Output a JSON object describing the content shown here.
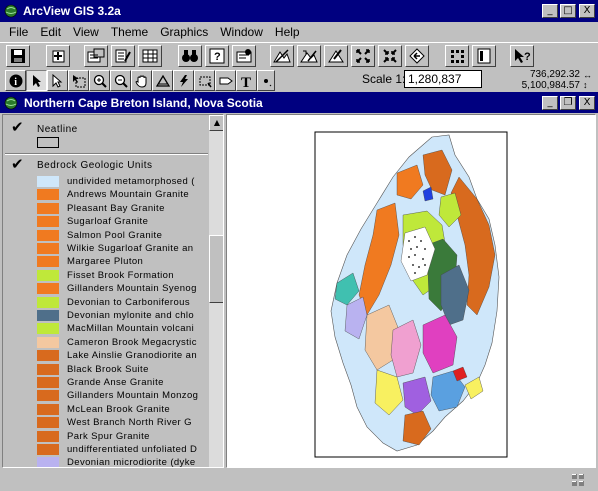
{
  "app": {
    "title": "ArcView GIS 3.2a",
    "window_buttons": [
      "_",
      "□",
      "X"
    ]
  },
  "menu": [
    "File",
    "Edit",
    "View",
    "Theme",
    "Graphics",
    "Window",
    "Help"
  ],
  "toolbar": {
    "buttons": [
      "save",
      "add-theme",
      "theme-properties",
      "edit-legend",
      "open-table",
      "find",
      "query-builder",
      "locate-address",
      "zoom-to-full-extent",
      "zoom-to-active-themes",
      "zoom-to-selected",
      "zoom-previous",
      "select-features",
      "help"
    ],
    "tools": [
      "identify",
      "pointer",
      "vertex-edit",
      "select-feature",
      "zoom-in",
      "zoom-out",
      "pan",
      "measure",
      "hotlink",
      "area-of-interest",
      "label",
      "text",
      "draw-point"
    ]
  },
  "scale": {
    "label": "Scale 1:",
    "value": "1,280,837"
  },
  "coords": {
    "x": "736,292.32",
    "y": "5,100,984.57"
  },
  "view": {
    "title": "Northern Cape Breton Island, Nova Scotia"
  },
  "toc": {
    "neatline": {
      "name": "Neatline",
      "checked": true
    },
    "bedrock": {
      "name": "Bedrock Geologic Units",
      "checked": true,
      "items": [
        {
          "label": "undivided metamorphosed (",
          "color": "#cfe7fa"
        },
        {
          "label": "Andrews Mountain Granite",
          "color": "#f07a20"
        },
        {
          "label": "Pleasant Bay Granite",
          "color": "#f07a20"
        },
        {
          "label": "Sugarloaf Granite",
          "color": "#f07a20"
        },
        {
          "label": "Salmon Pool Granite",
          "color": "#f07a20"
        },
        {
          "label": "Wilkie Sugarloaf Granite an",
          "color": "#f07a20"
        },
        {
          "label": "Margaree Pluton",
          "color": "#f07a20"
        },
        {
          "label": "Fisset Brook Formation",
          "color": "#bfe83a"
        },
        {
          "label": "Gillanders Mountain Syenog",
          "color": "#f07a20"
        },
        {
          "label": "Devonian to Carboniferous",
          "color": "#bfe83a"
        },
        {
          "label": "Devonian mylonite and chlo",
          "color": "#4f6f8a"
        },
        {
          "label": "MacMillan Mountain volcani",
          "color": "#bfe83a"
        },
        {
          "label": "Cameron Brook Megacrystic",
          "color": "#f4c8a0"
        },
        {
          "label": "Lake Ainslie Granodiorite an",
          "color": "#d86a1e"
        },
        {
          "label": "Black Brook Suite",
          "color": "#d86a1e"
        },
        {
          "label": "Grande Anse Granite",
          "color": "#d86a1e"
        },
        {
          "label": "Gillanders Mountain Monzog",
          "color": "#d86a1e"
        },
        {
          "label": "McLean Brook Granite",
          "color": "#d86a1e"
        },
        {
          "label": "West Branch North River G",
          "color": "#d86a1e"
        },
        {
          "label": "Park Spur Granite",
          "color": "#d86a1e"
        },
        {
          "label": "undifferentiated unfoliated D",
          "color": "#d86a1e"
        },
        {
          "label": "Devonian microdiorite (dyke",
          "color": "#b9b2f0"
        }
      ]
    }
  },
  "colors": {
    "title_bar": "#000080",
    "face": "#c0c0c0"
  }
}
